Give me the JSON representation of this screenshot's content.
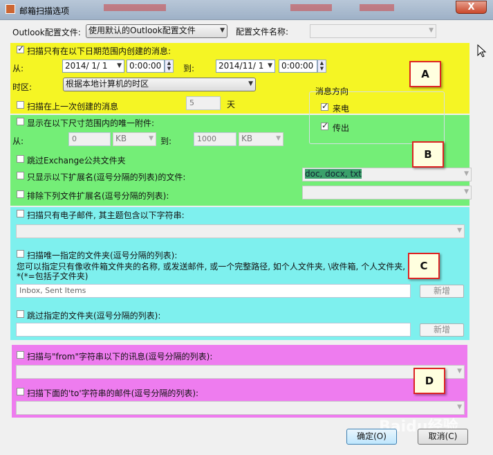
{
  "window": {
    "title": "邮箱扫描选项",
    "close_glyph": "X"
  },
  "profile": {
    "label": "Outlook配置文件:",
    "selected": "使用默认的Outlook配置文件",
    "name_label": "配置文件名称:",
    "name_value": ""
  },
  "date_section": {
    "checkbox_label": "扫描只有在以下日期范围内创建的消息:",
    "checked": true,
    "from_label": "从:",
    "from_date": "2014/ 1/ 1",
    "from_time": "0:00:00",
    "to_label": "到:",
    "to_date": "2014/11/ 1",
    "to_time": "0:00:00",
    "timezone_label": "时区:",
    "timezone_value": "根据本地计算机的时区",
    "last_created_label": "扫描在上一次创建的消息",
    "last_created_value": "5",
    "days_unit": "天"
  },
  "direction": {
    "title": "消息方向",
    "incoming": "来电",
    "outgoing": "传出",
    "incoming_checked": true,
    "outgoing_checked": true
  },
  "attachment_section": {
    "size_label": "显示在以下尺寸范围内的唯一附件:",
    "from_label": "从:",
    "from_value": "0",
    "from_unit": "KB",
    "to_label": "到:",
    "to_value": "1000",
    "to_unit": "KB",
    "skip_exchange_label": "跳过Exchange公共文件夹",
    "show_ext_label": "只显示以下扩展名(逗号分隔的列表)的文件:",
    "show_ext_value": "doc, docx, txt",
    "exclude_ext_label": "排除下列文件扩展名(逗号分隔的列表):",
    "exclude_ext_value": ""
  },
  "folder_section": {
    "subject_label": "扫描只有电子邮件, 其主题包含以下字符串:",
    "subject_value": "",
    "only_folders_label": "扫描唯一指定的文件夹(逗号分隔的列表):",
    "help_line1": "您可以指定只有像收件箱文件夹的名称, 或发送邮件, 或一个完整路径, 如个人文件夹, \\收件箱, 个人文件夹, 收件箱",
    "help_line2": "*(*=包括子文件夹)",
    "only_folders_value": "Inbox, Sent Items",
    "add_label": "新增",
    "skip_folders_label": "跳过指定的文件夹(逗号分隔的列表):",
    "skip_folders_value": "",
    "add_label_2": "新增"
  },
  "address_section": {
    "from_label": "扫描与\"from\"字符串以下的讯息(逗号分隔的列表):",
    "from_value": "",
    "to_label": "扫描下面的'to'字符串的邮件(逗号分隔的列表):",
    "to_value": ""
  },
  "markers": {
    "a": "A",
    "b": "B",
    "c": "C",
    "d": "D"
  },
  "buttons": {
    "ok": "确定(O)",
    "cancel": "取消(C)"
  },
  "watermark": "Baidu经验",
  "colors": {
    "zone_a": "#f5f524",
    "zone_b": "#74ee77",
    "zone_c": "#7ef0ee",
    "zone_d": "#ee7cef",
    "marker_border": "#dd2222"
  }
}
